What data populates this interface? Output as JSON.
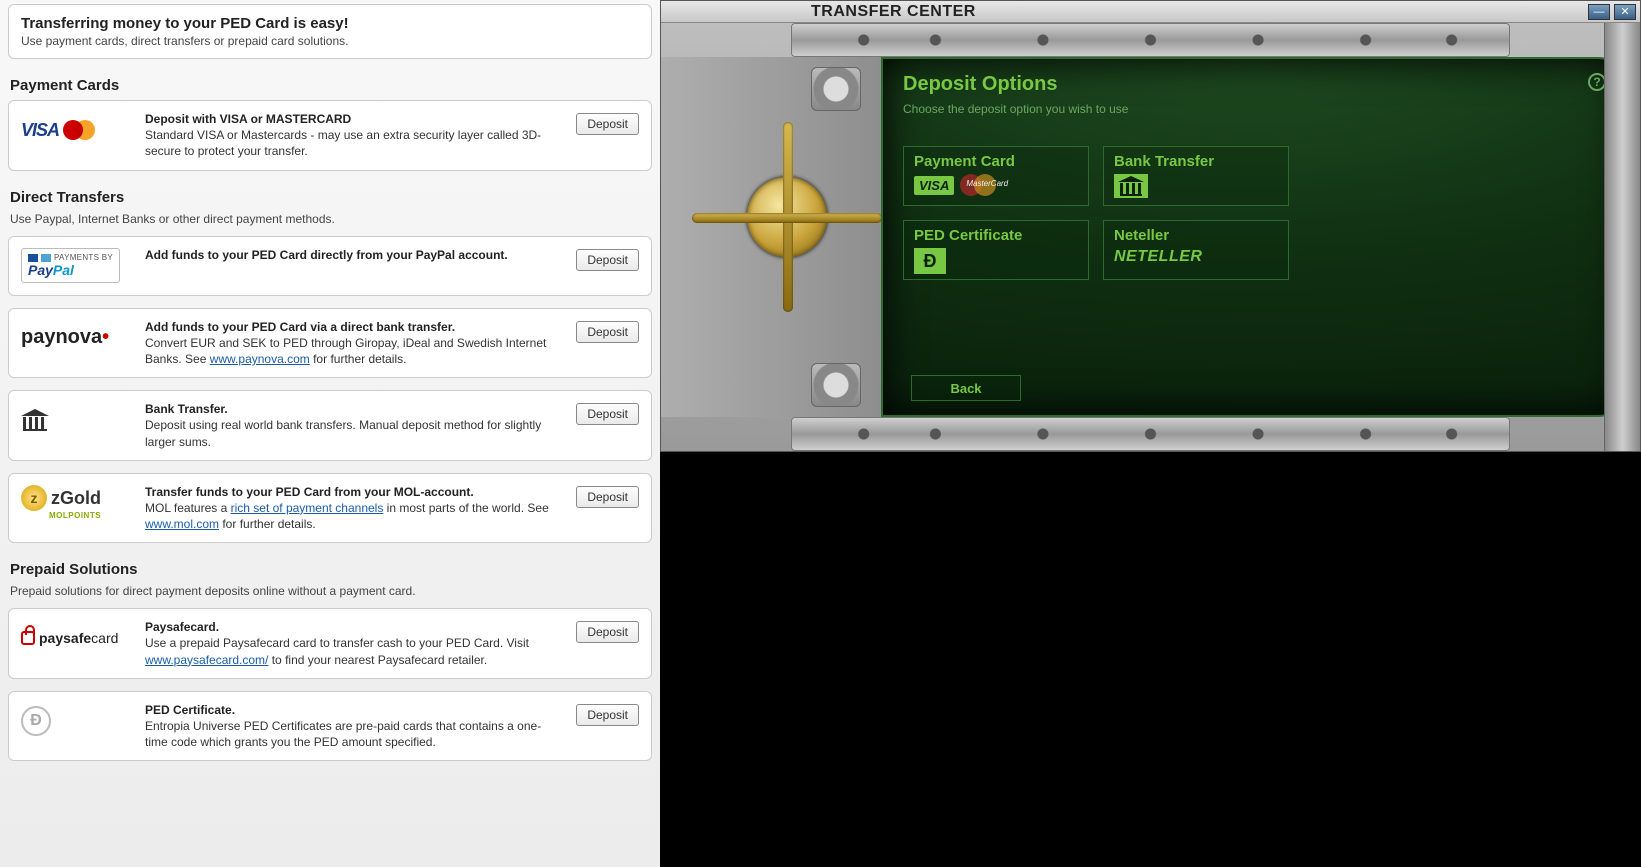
{
  "intro": {
    "title": "Transferring money to your PED Card is easy!",
    "sub": "Use payment cards, direct transfers or prepaid card solutions."
  },
  "deposit_label": "Deposit",
  "sections": {
    "payment_cards": {
      "head": "Payment Cards",
      "items": [
        {
          "logo": "visa-mc",
          "title": "Deposit with VISA or MASTERCARD",
          "desc": "Standard VISA or Mastercards - may use an extra security layer called 3D-secure to protect your transfer."
        }
      ]
    },
    "direct_transfers": {
      "head": "Direct Transfers",
      "sub": "Use Paypal, Internet Banks or other direct payment methods.",
      "items": [
        {
          "logo": "paypal",
          "title": "Add funds to your PED Card directly from your PayPal account.",
          "desc": ""
        },
        {
          "logo": "paynova",
          "title": "Add funds to your PED Card via a direct bank transfer.",
          "desc_pre": "Convert EUR and SEK to PED through Giropay, iDeal and Swedish Internet Banks. See ",
          "link": "www.paynova.com",
          "desc_post": " for further details."
        },
        {
          "logo": "bank",
          "title": "Bank Transfer.",
          "desc": "Deposit using real world bank transfers. Manual deposit method for slightly larger sums."
        },
        {
          "logo": "zgold",
          "title": "Transfer funds to your PED Card from your MOL-account.",
          "desc_pre": "MOL features a ",
          "link": "rich set of payment channels",
          "desc_mid": " in most parts of the world. See ",
          "link2": "www.mol.com",
          "desc_post": " for further details."
        }
      ]
    },
    "prepaid": {
      "head": "Prepaid Solutions",
      "sub": "Prepaid solutions for direct payment deposits online without a payment card.",
      "items": [
        {
          "logo": "paysafecard",
          "title": "Paysafecard.",
          "desc_pre": "Use a prepaid Paysafecard card to transfer cash to your PED Card. Visit ",
          "link": "www.paysafecard.com/",
          "desc_post": " to find your nearest Paysafecard retailer."
        },
        {
          "logo": "ped-cert",
          "title": "PED Certificate.",
          "desc": "Entropia Universe PED Certificates are pre-paid cards that contains a one-time code which grants you the PED amount specified."
        }
      ]
    }
  },
  "logos_text": {
    "visa": "VISA",
    "payments_by": "PAYMENTS BY",
    "paypal_pay": "Pay",
    "paypal_pal": "Pal",
    "paynova_pay": "pay",
    "paynova_nova": "nova",
    "zgold_z": "z",
    "zgold_text": "zGold",
    "zgold_sub": "MOLPOINTS",
    "psc_paysafe": "paysafe",
    "psc_card": "card",
    "ped_d": "Đ",
    "mastercard": "MasterCard"
  },
  "tc": {
    "title": "TRANSFER CENTER",
    "green_title": "Deposit Options",
    "green_sub": "Choose the deposit option you wish to use",
    "help": "?",
    "back": "Back",
    "options": [
      {
        "title": "Payment Card",
        "type": "visa-mc"
      },
      {
        "title": "Bank Transfer",
        "type": "bank"
      },
      {
        "title": "PED Certificate",
        "type": "ped"
      },
      {
        "title": "Neteller",
        "type": "neteller",
        "brand": "NETELLER"
      }
    ],
    "winbtns": {
      "min": "—",
      "close": "✕"
    }
  }
}
